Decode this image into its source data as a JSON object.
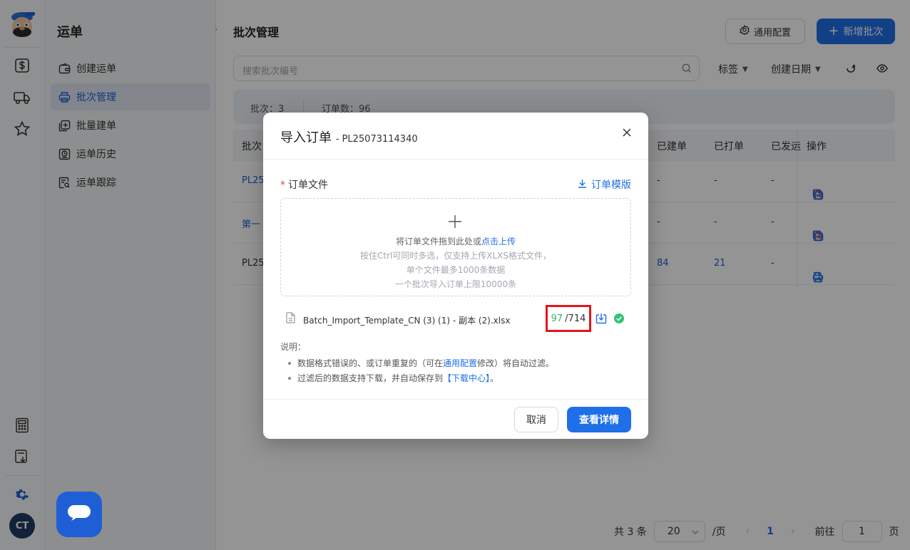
{
  "rail": {
    "avatar": "CT",
    "colors": {
      "brand": "#1f6fe8"
    }
  },
  "sidebar": {
    "title": "运单",
    "items": [
      {
        "label": "创建运单",
        "icon": "wallet-icon"
      },
      {
        "label": "批次管理",
        "icon": "printer-icon",
        "active": true
      },
      {
        "label": "批量建单",
        "icon": "add-square-icon"
      },
      {
        "label": "运单历史",
        "icon": "history-icon"
      },
      {
        "label": "运单跟踪",
        "icon": "tracking-icon"
      }
    ]
  },
  "main": {
    "title": "批次管理",
    "config_label": "通用配置",
    "add_label": "新增批次",
    "search_placeholder": "搜索批次编号",
    "filter_tag": "标签",
    "filter_date": "创建日期",
    "summary": {
      "batches": "批次：3",
      "orders": "订单数：96"
    },
    "table": {
      "headers": [
        "批次",
        "已建单",
        "已打单",
        "已发运",
        "操作"
      ],
      "rows": [
        {
          "id": "PL25",
          "created": "-",
          "printed": "-",
          "shipped": "-"
        },
        {
          "id": "第一",
          "created": "-",
          "printed": "-",
          "shipped": "-"
        },
        {
          "id": "PL25",
          "created": "84",
          "printed": "21",
          "shipped": "-"
        }
      ]
    },
    "pager": {
      "total": "共 3 条",
      "page_size": "20",
      "per_page": "/页",
      "current": "1",
      "goto_label": "前往",
      "goto_value": "1",
      "page_suffix": "页"
    }
  },
  "modal": {
    "title": "导入订单",
    "subtitle": "- PL25073114340",
    "field_label": "订单文件",
    "template_link": "订单模版",
    "drop_text_prefix": "将订单文件拖到此处或",
    "drop_text_link": "点击上传",
    "hint_1": "按住Ctrl可同时多选，仅支持上传XLXS格式文件，",
    "hint_2": "单个文件最多1000条数据",
    "hint_3": "一个批次导入订单上限10000条",
    "file_name": "Batch_Import_Template_CN (3) (1) - 副本 (2).xlsx",
    "valid_count": "97",
    "total_count": "/714",
    "notes_title": "说明：",
    "note1_prefix": "数据格式错误的、或订单重复的（可在",
    "note1_link": "通用配置",
    "note1_suffix": "修改）将自动过滤。",
    "note2_prefix": "过滤后的数据支持下载，并自动保存到",
    "note2_link": "【下载中心】",
    "note2_suffix": "。",
    "cancel_label": "取消",
    "detail_label": "查看详情"
  }
}
